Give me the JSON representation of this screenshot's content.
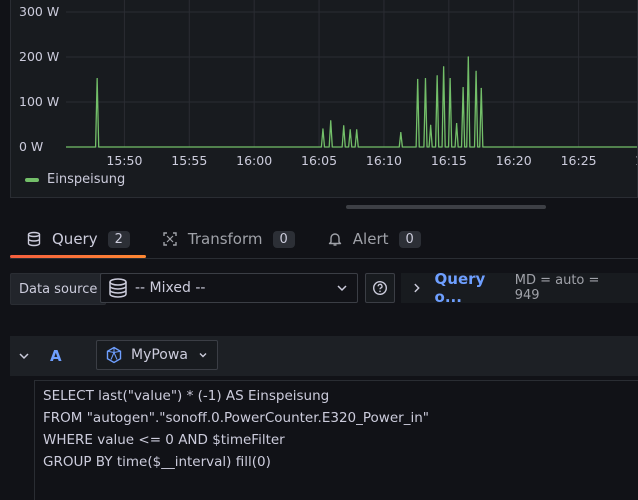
{
  "chart_data": {
    "type": "line",
    "title": "",
    "xlabel": "",
    "ylabel": "",
    "ylim": [
      0,
      300
    ],
    "yticks": [
      "0 W",
      "100 W",
      "200 W",
      "300 W"
    ],
    "yvalues": [
      0,
      100,
      200,
      300
    ],
    "xticks": [
      "15:50",
      "15:55",
      "16:00",
      "16:05",
      "16:10",
      "16:15",
      "16:20",
      "16:25"
    ],
    "xticks_min": [
      950,
      955,
      960,
      965,
      970,
      975,
      980,
      985
    ],
    "xlim_min": [
      945.5,
      989.5
    ],
    "series": [
      {
        "name": "Einspeisung",
        "color": "#73bf69",
        "spikes_min": [
          [
            947.9,
            152
          ],
          [
            965.3,
            40
          ],
          [
            965.9,
            58
          ],
          [
            966.9,
            47
          ],
          [
            967.4,
            38
          ],
          [
            967.9,
            38
          ],
          [
            971.3,
            32
          ],
          [
            972.6,
            150
          ],
          [
            973.2,
            152
          ],
          [
            973.6,
            48
          ],
          [
            974.1,
            158
          ],
          [
            974.6,
            178
          ],
          [
            975.1,
            152
          ],
          [
            975.6,
            52
          ],
          [
            976.1,
            132
          ],
          [
            976.5,
            200
          ],
          [
            977.1,
            168
          ],
          [
            977.5,
            130
          ]
        ]
      }
    ],
    "legend_position": "bottom-left",
    "grid": true
  },
  "legend": {
    "label": "Einspeisung"
  },
  "tabs": [
    {
      "label": "Query",
      "count": "2",
      "icon": "database-icon",
      "active": true
    },
    {
      "label": "Transform",
      "count": "0",
      "icon": "transform-icon",
      "active": false
    },
    {
      "label": "Alert",
      "count": "0",
      "icon": "bell-icon",
      "active": false
    }
  ],
  "datasource": {
    "label": "Data source",
    "value": "-- Mixed --"
  },
  "query_options": {
    "title": "Query o...",
    "meta": "MD = auto = 949"
  },
  "query": {
    "ref_id": "A",
    "datasource": "MyPowa",
    "lines": [
      "SELECT last(\"value\") * (-1) AS Einspeisung",
      "FROM \"autogen\".\"sonoff.0.PowerCounter.E320_Power_in\"",
      "WHERE value <= 0 AND $timeFilter",
      "GROUP BY time($__interval) fill(0)"
    ]
  },
  "colors": {
    "accent": "#6e9fff",
    "series": "#73bf69",
    "tab_underline": "#ff5f36"
  }
}
